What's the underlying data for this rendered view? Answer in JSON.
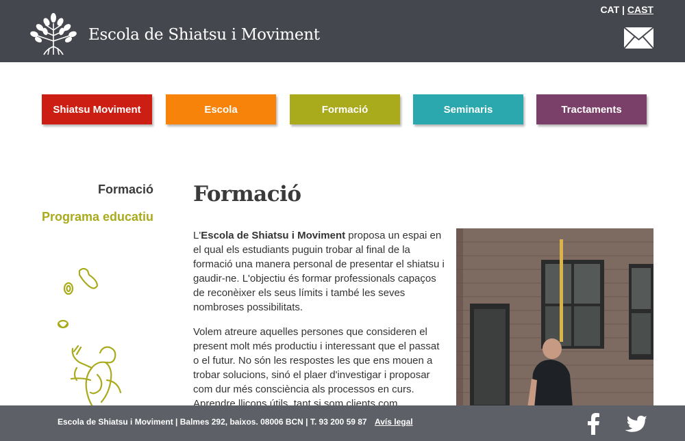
{
  "header": {
    "site_title": "Escola de Shiatsu i Moviment",
    "lang_cat": "CAT",
    "lang_sep": " | ",
    "lang_cast": "CAST",
    "icons": {
      "logo": "tree-logo-icon",
      "mail": "envelope-icon"
    }
  },
  "nav": {
    "items": [
      {
        "label": "Shiatsu Moviment",
        "color": "#cc1e12"
      },
      {
        "label": "Escola",
        "color": "#f7830a"
      },
      {
        "label": "Formació",
        "color": "#a9aa1c"
      },
      {
        "label": "Seminaris",
        "color": "#2aa8ad"
      },
      {
        "label": "Tractaments",
        "color": "#7b4069"
      }
    ]
  },
  "sidebar": {
    "title": "Formació",
    "link": "Programa educatiu",
    "accent_color": "#a9aa1c"
  },
  "main": {
    "title": "Formació",
    "p1_prefix": "L'",
    "p1_bold": "Escola de Shiatsu i Moviment",
    "p1_rest": " proposa un espai en el qual els estudiants puguin trobar al final de la formació una manera personal de presentar el shiatsu i gaudir-ne. L'objectiu és formar professionals capaços de reconèixer els seus límits i també les seves nombroses possibilitats.",
    "p2": "Volem atreure aquelles persones que consideren el present molt més productiu i interessant que el passat o el futur. No són les respostes les que ens mouen a trobar solucions, sinó el plaer d'investigar i proposar com dur més consciència als processos en curs. Aprendre lliçons útils, tant si som clients com"
  },
  "footer": {
    "text": "Escola de Shiatsu i Moviment | Balmes 292, baixos. 08006 BCN | T. 93 200 59 87",
    "legal": "Avís legal",
    "icons": {
      "facebook": "facebook-icon",
      "twitter": "twitter-icon"
    }
  }
}
